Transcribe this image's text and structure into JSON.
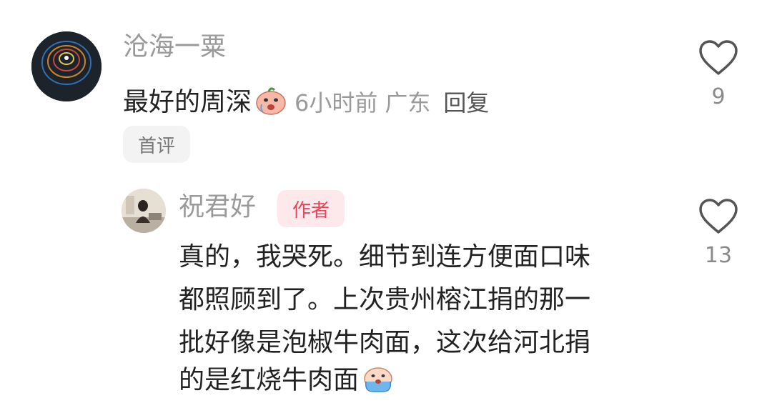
{
  "comment": {
    "username": "沧海一粟",
    "text": "最好的周深",
    "emoji": "cry-face-icon",
    "time": "6小时前",
    "location": "广东",
    "reply_label": "回复",
    "badge": "首评",
    "likes": "9"
  },
  "reply": {
    "username": "祝君好",
    "author_badge": "作者",
    "lines": [
      "真的，我哭死。细节到连方便面口味",
      "都照顾到了。上次贵州榕江捐的那一",
      "批好像是泡椒牛肉面，这次给河北捐",
      "的是红烧牛肉面"
    ],
    "emoji": "tears-face-icon",
    "likes": "13"
  },
  "colors": {
    "author_badge_text": "#e8455b",
    "author_badge_bg": "#fde9ec",
    "muted_text": "#9a9a9a"
  }
}
